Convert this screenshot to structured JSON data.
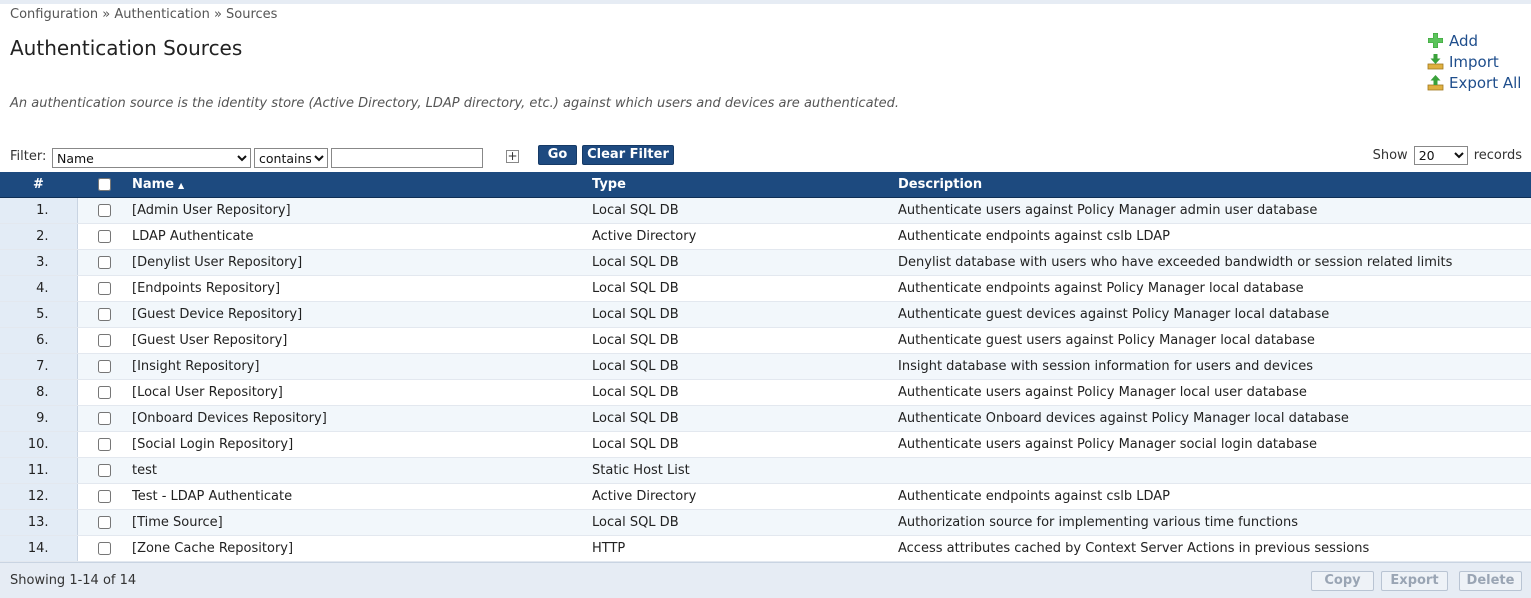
{
  "breadcrumb": "Configuration » Authentication » Sources",
  "page_title": "Authentication Sources",
  "description": "An authentication source is the identity store (Active Directory, LDAP directory, etc.) against which users and devices are authenticated.",
  "actions": {
    "add": "Add",
    "import": "Import",
    "export_all": "Export All"
  },
  "filter": {
    "label": "Filter:",
    "field_value": "Name",
    "operator_value": "contains",
    "input_value": "",
    "plus": "+",
    "go": "Go",
    "clear": "Clear Filter"
  },
  "show": {
    "prefix": "Show",
    "value": "20",
    "suffix": "records"
  },
  "table": {
    "columns": {
      "num": "#",
      "name": "Name",
      "type": "Type",
      "description": "Description"
    },
    "rows": [
      {
        "num": "1.",
        "name": "[Admin User Repository]",
        "type": "Local SQL DB",
        "description": "Authenticate users against Policy Manager admin user database"
      },
      {
        "num": "2.",
        "name": "LDAP Authenticate",
        "type": "Active Directory",
        "description": "Authenticate endpoints against cslb LDAP"
      },
      {
        "num": "3.",
        "name": "[Denylist User Repository]",
        "type": "Local SQL DB",
        "description": "Denylist database with users who have exceeded bandwidth or session related limits"
      },
      {
        "num": "4.",
        "name": "[Endpoints Repository]",
        "type": "Local SQL DB",
        "description": "Authenticate endpoints against Policy Manager local database"
      },
      {
        "num": "5.",
        "name": "[Guest Device Repository]",
        "type": "Local SQL DB",
        "description": "Authenticate guest devices against Policy Manager local database"
      },
      {
        "num": "6.",
        "name": "[Guest User Repository]",
        "type": "Local SQL DB",
        "description": "Authenticate guest users against Policy Manager local database"
      },
      {
        "num": "7.",
        "name": "[Insight Repository]",
        "type": "Local SQL DB",
        "description": "Insight database with session information for users and devices"
      },
      {
        "num": "8.",
        "name": "[Local User Repository]",
        "type": "Local SQL DB",
        "description": "Authenticate users against Policy Manager local user database"
      },
      {
        "num": "9.",
        "name": "[Onboard Devices Repository]",
        "type": "Local SQL DB",
        "description": "Authenticate Onboard devices against Policy Manager local database"
      },
      {
        "num": "10.",
        "name": "[Social Login Repository]",
        "type": "Local SQL DB",
        "description": "Authenticate users against Policy Manager social login database"
      },
      {
        "num": "11.",
        "name": "test",
        "type": "Static Host List",
        "description": ""
      },
      {
        "num": "12.",
        "name": "Test - LDAP Authenticate",
        "type": "Active Directory",
        "description": "Authenticate endpoints against cslb LDAP"
      },
      {
        "num": "13.",
        "name": "[Time Source]",
        "type": "Local SQL DB",
        "description": "Authorization source for implementing various time functions"
      },
      {
        "num": "14.",
        "name": "[Zone Cache Repository]",
        "type": "HTTP",
        "description": "Access attributes cached by Context Server Actions in previous sessions"
      }
    ]
  },
  "footer": {
    "showing": "Showing 1-14 of 14",
    "copy": "Copy",
    "export": "Export",
    "delete": "Delete"
  },
  "colors": {
    "header_bg": "#1d4a7f",
    "link": "#1f4e8c",
    "icon_green": "#3aa13a"
  }
}
